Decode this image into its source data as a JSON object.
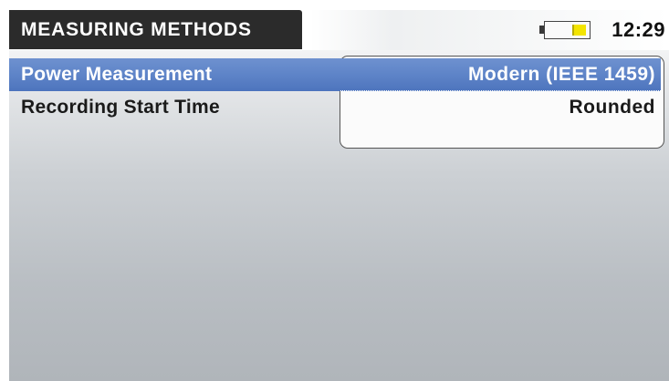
{
  "header": {
    "title": "MEASURING METHODS",
    "time": "12:29",
    "battery_level": 0.3,
    "battery_color": "#f3e400"
  },
  "settings": [
    {
      "label": "Power Measurement",
      "value": "Modern (IEEE 1459)",
      "selected": true
    },
    {
      "label": "Recording Start Time",
      "value": "Rounded",
      "selected": false
    }
  ],
  "colors": {
    "title_bg": "#2b2b2b",
    "selection_bg": "#5e84c8"
  }
}
